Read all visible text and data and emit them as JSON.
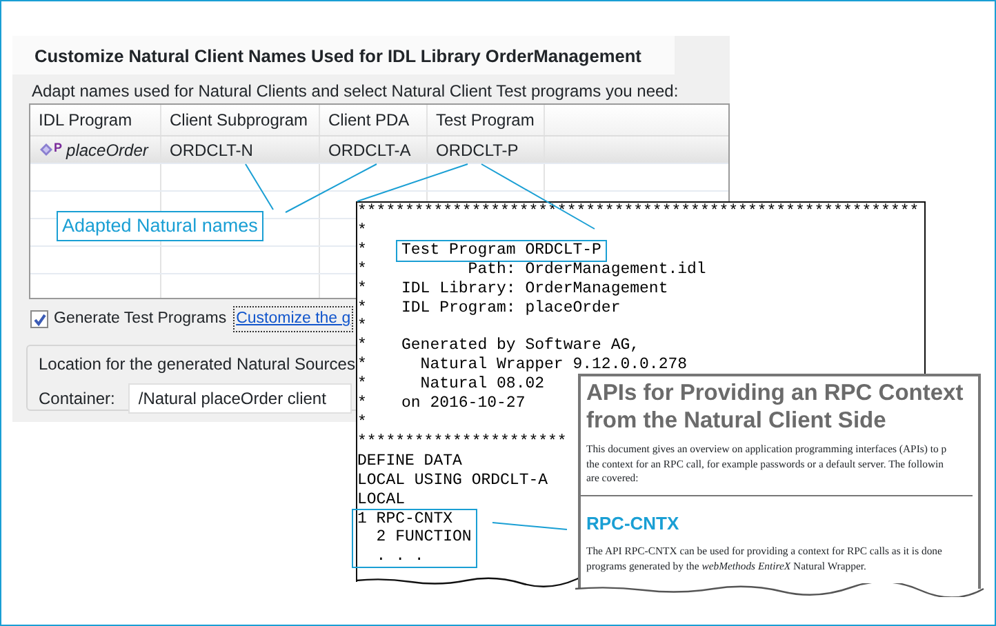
{
  "dialog": {
    "title": "Customize Natural Client Names Used for IDL Library OrderManagement",
    "instruction": "Adapt names used for Natural Clients and select Natural Client Test programs you need:",
    "table": {
      "columns": [
        "IDL Program",
        "Client Subprogram",
        "Client PDA",
        "Test Program"
      ],
      "rows": [
        {
          "selected": true,
          "icon_letter": "P",
          "cells": [
            "placeOrder",
            "ORDCLT-N",
            "ORDCLT-A",
            "ORDCLT-P"
          ]
        }
      ]
    },
    "generate_test_programs": {
      "label": "Generate Test Programs",
      "checked": true
    },
    "customize_link": "Customize the g",
    "location_group": {
      "title": "Location for the generated Natural Sources",
      "container_label": "Container:",
      "container_value": "/Natural placeOrder client"
    }
  },
  "callouts": [
    {
      "text": "Adapted Natural names"
    }
  ],
  "code_listing": {
    "border_line": "***********************************************************",
    "blocks": [
      {
        "boxed": false,
        "lines": [
          {
            "margin": "*"
          }
        ]
      },
      {
        "boxed": true,
        "lines": [
          {
            "margin": "*",
            "text": "Test Program ORDCLT-P"
          }
        ]
      },
      {
        "boxed": false,
        "lines": [
          {
            "margin": "*",
            "text": "       Path: OrderManagement.idl"
          },
          {
            "margin": "*",
            "text": "IDL Library: OrderManagement"
          },
          {
            "margin": "*",
            "text": "IDL Program: placeOrder"
          },
          {
            "margin": "*"
          },
          {
            "margin": "*",
            "text": "Generated by Software AG,"
          },
          {
            "margin": "*",
            "text": "  Natural Wrapper 9.12.0.0.278"
          },
          {
            "margin": "*",
            "text": "  Natural 08.02"
          },
          {
            "margin": "*",
            "text": "on 2016-10-27"
          },
          {
            "margin": "*"
          }
        ]
      },
      {
        "boxed": false,
        "lines": [
          {
            "text": "**********************"
          },
          {
            "text": "DEFINE DATA"
          },
          {
            "text": "LOCAL USING ORDCLT-A"
          },
          {
            "text": "LOCAL"
          }
        ]
      },
      {
        "boxed": true,
        "lines": [
          {
            "text": "1 RPC-CNTX"
          },
          {
            "text": "  2 FUNCTION"
          },
          {
            "text": "  . . ."
          }
        ]
      }
    ]
  },
  "document": {
    "title_lines": [
      "APIs for Providing an RPC Context",
      "from the Natural Client Side"
    ],
    "intro_lines": [
      "This document gives an overview on application programming interfaces (APIs) to p",
      "the context for an RPC call, for example passwords or a default server. The followin",
      "are covered:"
    ],
    "section_heading": "RPC-CNTX",
    "section_lines": [
      "The API RPC-CNTX can be used for providing a context for RPC calls as it is done",
      "programs generated by the *webMethods EntireX* Natural Wrapper."
    ]
  }
}
